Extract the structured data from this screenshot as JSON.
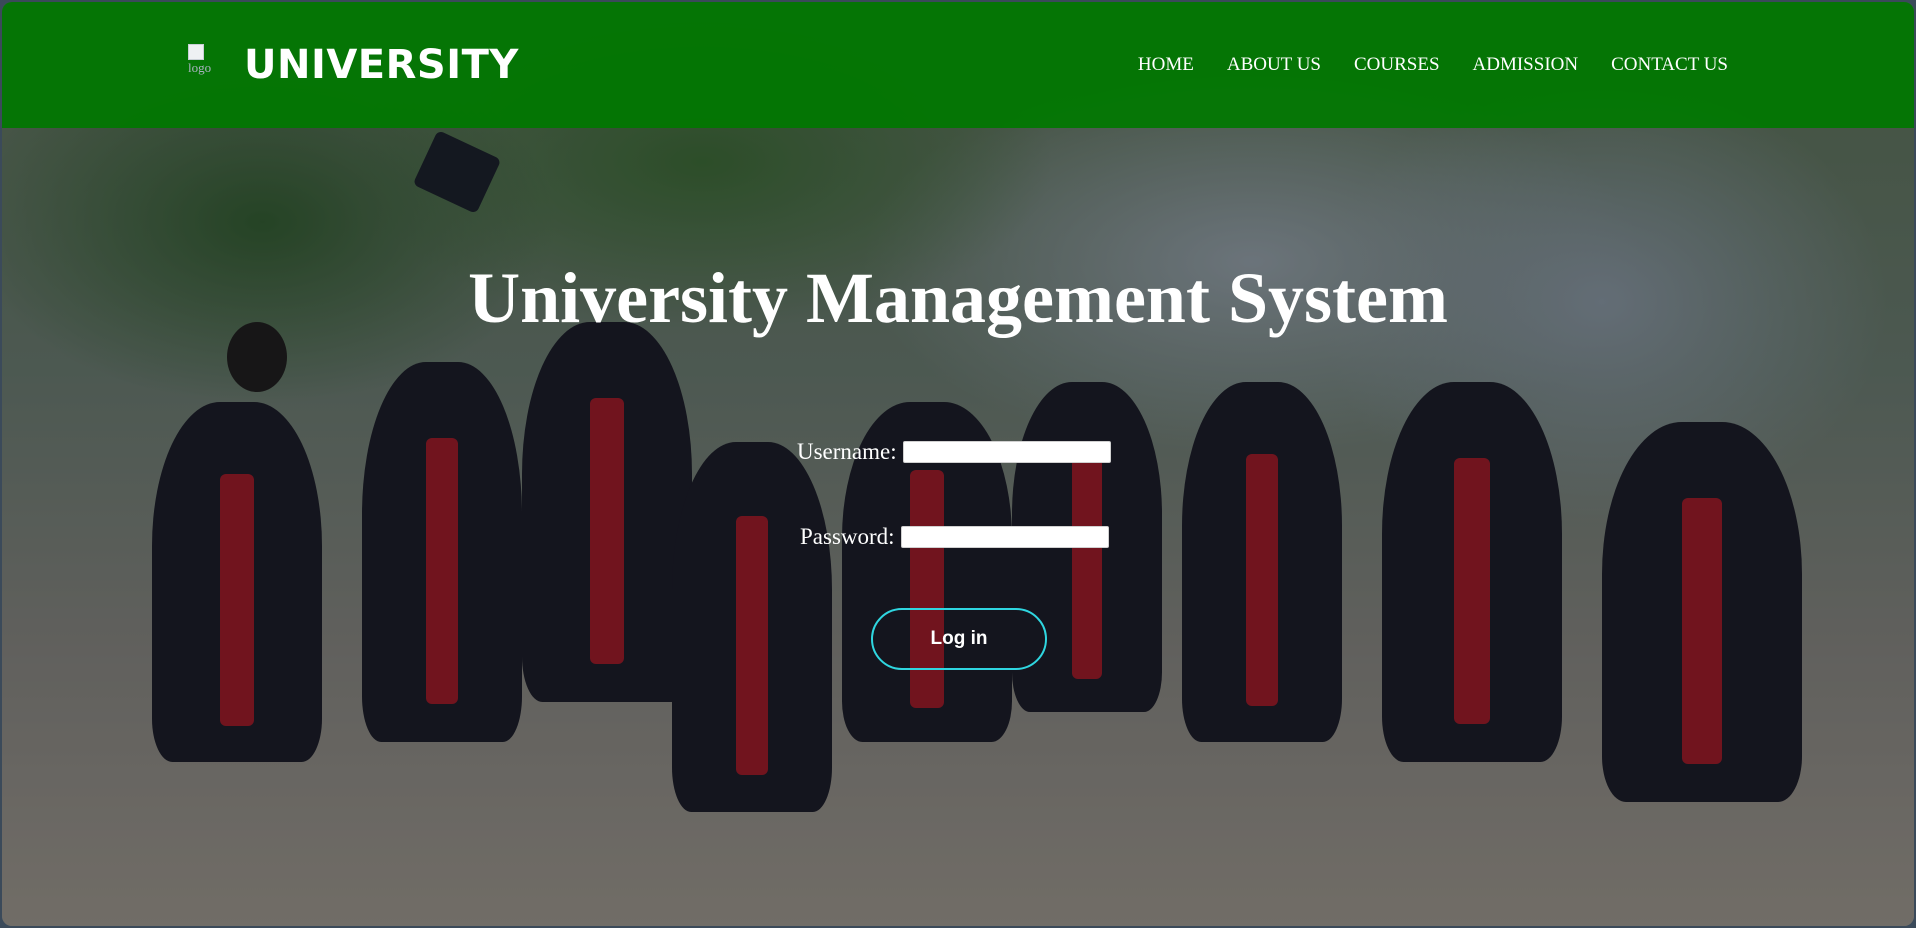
{
  "navbar": {
    "logo_alt": "logo",
    "brand": "UNIVERSITY",
    "menu": [
      {
        "label": "HOME"
      },
      {
        "label": "ABOUT US"
      },
      {
        "label": "COURSES"
      },
      {
        "label": "ADMISSION"
      },
      {
        "label": "CONTACT US"
      }
    ]
  },
  "main": {
    "title": "University Management System",
    "username_label": "Username:",
    "username_value": "",
    "password_label": "Password:",
    "password_value": "",
    "login_label": "Log in"
  },
  "colors": {
    "navbar": "#007800",
    "button_border": "#2fd6e0",
    "text": "#ffffff"
  }
}
